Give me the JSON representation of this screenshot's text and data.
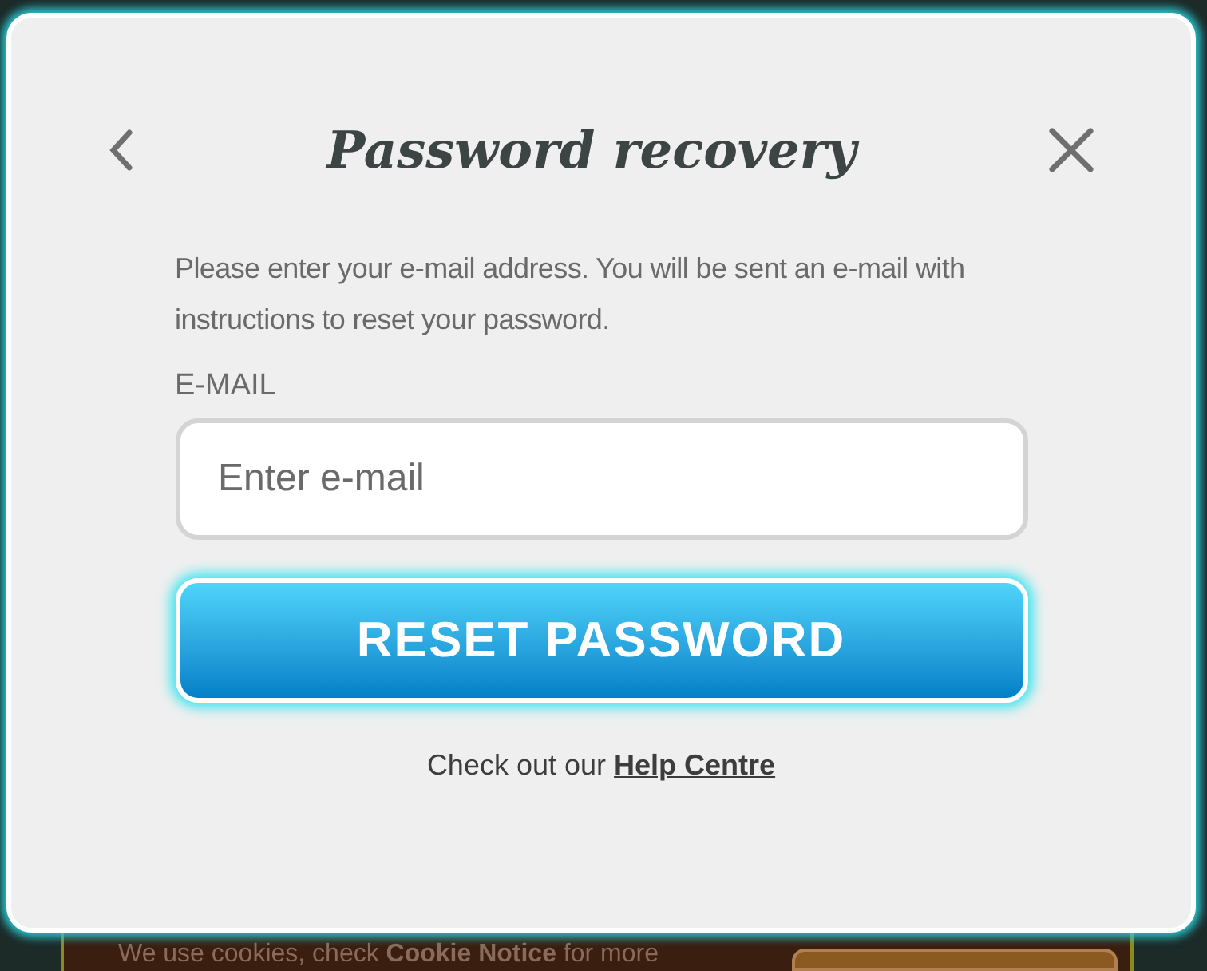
{
  "dialog": {
    "title": "Password recovery",
    "description": "Please enter your e-mail address. You will be sent an e-mail with instructions to reset your password.",
    "email_label": "E-MAIL",
    "email_field": {
      "placeholder": "Enter e-mail"
    },
    "submit_button": "RESET PASSWORD",
    "help_text": "Check out our",
    "help_link": "Help Centre"
  },
  "cookie_banner": {
    "text": "We use cookies, check **Cookie Notice** for more"
  }
}
